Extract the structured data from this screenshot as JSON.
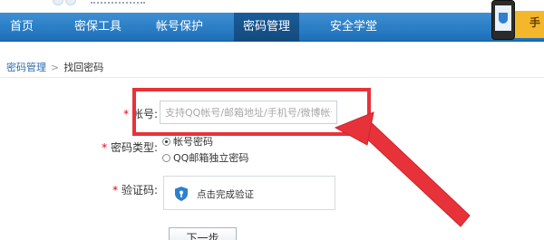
{
  "nav": {
    "items": [
      "首页",
      "密保工具",
      "帐号保护",
      "密码管理",
      "安全学堂"
    ],
    "active": "密码管理"
  },
  "promo": {
    "char": "手"
  },
  "breadcrumb": {
    "root": "密码管理",
    "separator": ">",
    "current": "找回密码"
  },
  "form": {
    "required_mark": "*",
    "account_label": "帐号:",
    "account_placeholder": "支持QQ帐号/邮箱地址/手机号/微博帐号",
    "account_value": "",
    "pwd_type_label": "密码类型:",
    "pwd_type_options": [
      {
        "label": "帐号密码",
        "checked": true
      },
      {
        "label": "QQ邮箱独立密码",
        "checked": false
      }
    ],
    "captcha_label": "验证码:",
    "captcha_text": "点击完成验证",
    "next_button": "下一步"
  },
  "annotation": {
    "highlight_color": "#e8323a"
  },
  "colors": {
    "nav_bg": "#1c6fb8",
    "nav_active": "#134a7d",
    "link": "#2a6cb0",
    "required": "#e60012"
  }
}
